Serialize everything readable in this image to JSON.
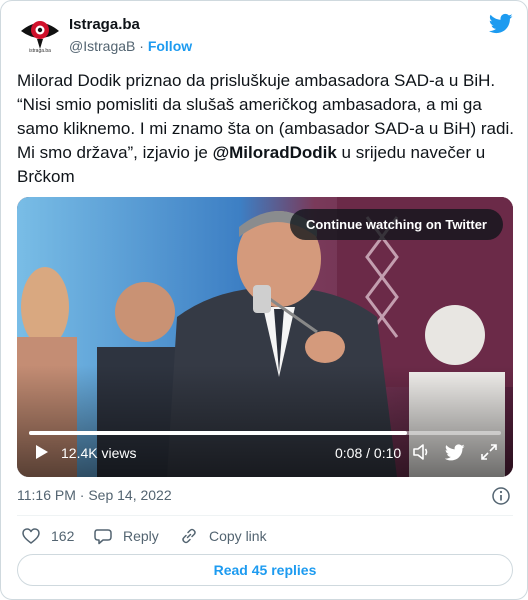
{
  "author": {
    "name": "Istraga.ba",
    "handle": "@IstragaB",
    "separator": "·",
    "follow_label": "Follow",
    "avatar_caption": "istraga.ba"
  },
  "tweet": {
    "text_before": "Milorad Dodik priznao da prisluškuje ambasadora SAD-a u BiH. “Nisi smio pomisliti da slušaš američkog ambasadora, a mi ga samo kliknemo. I mi znamo šta on (ambasador SAD-a u BiH) radi. Mi smo država”, izjavio je ",
    "mention": "@MiloradDodik",
    "text_after": " u srijedu navečer u Brčkom"
  },
  "video": {
    "continue_label": "Continue watching on Twitter",
    "views": "12.4K views",
    "time": "0:08 / 0:10",
    "progress": 0.8
  },
  "meta": {
    "timestamp": "11:16 PM · Sep 14, 2022"
  },
  "actions": {
    "likes": "162",
    "reply_label": "Reply",
    "copy_link_label": "Copy link"
  },
  "read_replies_label": "Read 45 replies",
  "colors": {
    "accent": "#1d9bf0",
    "like": "#f91880",
    "text": "#0f1419",
    "secondary": "#536471"
  }
}
